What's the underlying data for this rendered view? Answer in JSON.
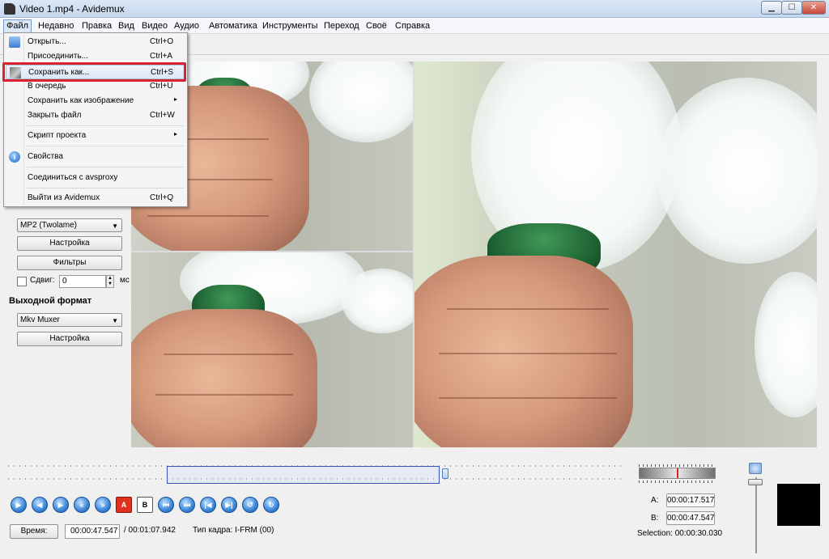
{
  "window": {
    "title": "Video 1.mp4 - Avidemux",
    "min_glyph": "▁",
    "max_glyph": "☐",
    "close_glyph": "✕"
  },
  "menubar": {
    "items": [
      "Файл",
      "Недавно",
      "Правка",
      "Вид",
      "Видео",
      "Аудио",
      "Автоматика",
      "Инструменты",
      "Переход",
      "Своё",
      "Справка"
    ]
  },
  "file_menu": {
    "items": [
      {
        "label": "Открыть...",
        "shortcut": "Ctrl+O",
        "icon": "open-icon"
      },
      {
        "label": "Присоединить...",
        "shortcut": "Ctrl+A"
      },
      {
        "label": "Сохранить как...",
        "shortcut": "Ctrl+S",
        "icon": "save-icon",
        "highlighted": true
      },
      {
        "label": "В очередь",
        "shortcut": "Ctrl+U"
      },
      {
        "label": "Сохранить как изображение",
        "submenu": "▸"
      },
      {
        "label": "Закрыть файл",
        "shortcut": "Ctrl+W"
      },
      {
        "label": "Скрипт проекта",
        "submenu": "▸"
      },
      {
        "label": "Свойства",
        "icon": "info-icon"
      },
      {
        "label": "Соединиться с avsproxy"
      },
      {
        "label": "Выйти из Avidemux",
        "shortcut": "Ctrl+Q"
      }
    ]
  },
  "left_panel": {
    "audio_codec": "MP2 (Twolame)",
    "configure_button": "Настройка",
    "filters_button": "Фильтры",
    "shift_label": "Сдвиг:",
    "shift_value": "0",
    "shift_unit": "мс",
    "output_format_title": "Выходной формат",
    "output_format": "Mkv Muxer",
    "output_configure_button": "Настройка"
  },
  "playback": {
    "time_button": "Время:",
    "current_time": "00:00:47.547",
    "total_time": "/ 00:01:07.942",
    "frame_type": "Тип кадра:  I-FRM (00)",
    "a_label": "A:",
    "a_value": "00:00:17.517",
    "b_label": "B:",
    "b_value": "00:00:47.547",
    "selection": "Selection: 00:00:30.030"
  },
  "nav_buttons": [
    "▶",
    "◀",
    "▶",
    "«",
    "»",
    "A",
    "B",
    "⏮",
    "⏭",
    "|◀",
    "▶|",
    "↺",
    "↻"
  ],
  "colors": {
    "highlight_box": "#d9232f",
    "selection_border": "#3a52b8"
  }
}
